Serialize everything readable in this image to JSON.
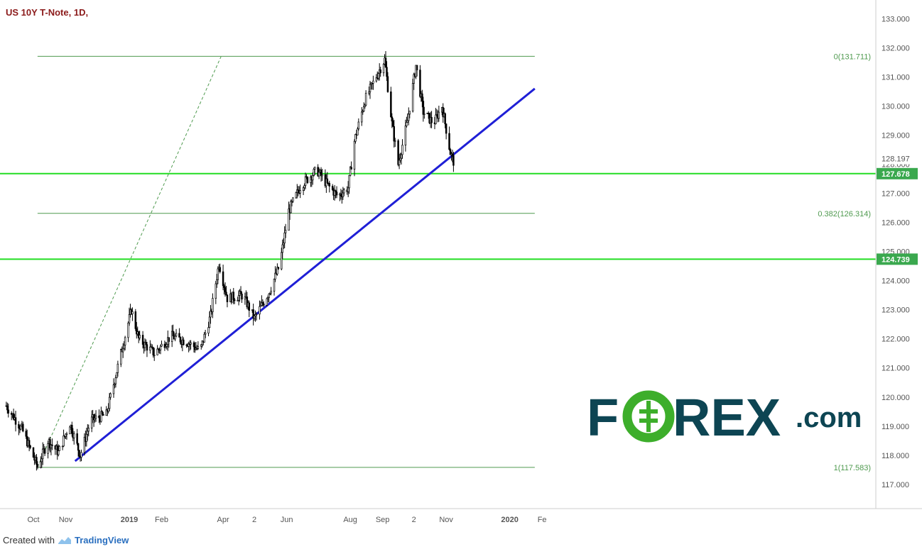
{
  "header": {
    "title": "US 10Y T-Note, 1D,"
  },
  "footer": {
    "created_with": "Created with",
    "brand": "TradingView"
  },
  "watermark": {
    "text_left": "F",
    "text_o": "O",
    "text_right": "REX",
    "text_com": ".com",
    "color_dark": "#0d4553",
    "color_green": "#3dae2b"
  },
  "colors": {
    "candle": "#000000",
    "trend": "#1f1fd6",
    "level": "#22dd22",
    "fib": "#4f9a4f",
    "level_tag": "#3aa84e",
    "price_tag": "#ffffff"
  },
  "chart_data": {
    "type": "candlestick",
    "title": "US 10Y T-Note, 1D,",
    "ylim": [
      116.2,
      133.4
    ],
    "y_ticks": [
      "117.000",
      "118.000",
      "119.000",
      "120.000",
      "121.000",
      "122.000",
      "123.000",
      "124.000",
      "125.000",
      "126.000",
      "127.000",
      "128.000",
      "129.000",
      "130.000",
      "131.000",
      "132.000",
      "133.000"
    ],
    "x_ticks": [
      "Oct",
      "Nov",
      "2019",
      "Feb",
      "Apr",
      "2",
      "Jun",
      "Aug",
      "Sep",
      "2",
      "Nov",
      "2020",
      "Fe"
    ],
    "x_tick_dates": [
      "2018-10-01",
      "2018-11-01",
      "2019-01-01",
      "2019-02-01",
      "2019-04-01",
      "2019-05-01",
      "2019-06-01",
      "2019-08-01",
      "2019-09-01",
      "2019-10-01",
      "2019-11-01",
      "2020-01-01",
      "2020-02-01"
    ],
    "price_path": [
      [
        "2018-09-05",
        119.7
      ],
      [
        "2018-09-20",
        118.9
      ],
      [
        "2018-10-05",
        117.6
      ],
      [
        "2018-10-15",
        118.5
      ],
      [
        "2018-10-25",
        118.1
      ],
      [
        "2018-11-05",
        119.1
      ],
      [
        "2018-11-15",
        118.0
      ],
      [
        "2018-11-25",
        119.2
      ],
      [
        "2018-12-10",
        119.4
      ],
      [
        "2018-12-20",
        120.9
      ],
      [
        "2019-01-03",
        123.0
      ],
      [
        "2019-01-10",
        122.0
      ],
      [
        "2019-01-25",
        121.5
      ],
      [
        "2019-02-10",
        122.1
      ],
      [
        "2019-02-25",
        121.9
      ],
      [
        "2019-03-10",
        121.6
      ],
      [
        "2019-03-20",
        122.8
      ],
      [
        "2019-03-28",
        124.6
      ],
      [
        "2019-04-05",
        123.4
      ],
      [
        "2019-04-20",
        123.5
      ],
      [
        "2019-05-01",
        122.7
      ],
      [
        "2019-05-15",
        123.6
      ],
      [
        "2019-05-25",
        124.5
      ],
      [
        "2019-06-03",
        126.4
      ],
      [
        "2019-06-15",
        127.3
      ],
      [
        "2019-06-30",
        127.8
      ],
      [
        "2019-07-10",
        127.3
      ],
      [
        "2019-07-20",
        126.9
      ],
      [
        "2019-07-30",
        127.2
      ],
      [
        "2019-08-05",
        128.8
      ],
      [
        "2019-08-15",
        130.2
      ],
      [
        "2019-08-27",
        131.1
      ],
      [
        "2019-09-03",
        131.6
      ],
      [
        "2019-09-10",
        129.4
      ],
      [
        "2019-09-16",
        128.0
      ],
      [
        "2019-09-25",
        129.5
      ],
      [
        "2019-10-03",
        131.4
      ],
      [
        "2019-10-10",
        129.8
      ],
      [
        "2019-10-20",
        129.4
      ],
      [
        "2019-10-28",
        130.0
      ],
      [
        "2019-11-05",
        128.4
      ],
      [
        "2019-11-08",
        128.1
      ]
    ],
    "last_price": "128.197",
    "levels": [
      {
        "value": 127.678,
        "label": "127.678"
      },
      {
        "value": 124.739,
        "label": "124.739"
      }
    ],
    "fibonacci": {
      "start_date": "2018-10-05",
      "end_date": "2020-01-25",
      "levels": [
        {
          "value": 131.711,
          "label": "0(131.711)"
        },
        {
          "value": 126.314,
          "label": "0.382(126.314)"
        },
        {
          "value": 117.583,
          "label": "1(117.583)"
        }
      ]
    },
    "trendline": {
      "start": [
        "2018-11-10",
        117.8
      ],
      "end": [
        "2020-01-25",
        130.6
      ]
    },
    "dashed_line": {
      "start": [
        "2018-10-05",
        117.6
      ],
      "end": [
        "2019-03-30",
        131.7
      ]
    },
    "legend": "none",
    "grid": false
  }
}
